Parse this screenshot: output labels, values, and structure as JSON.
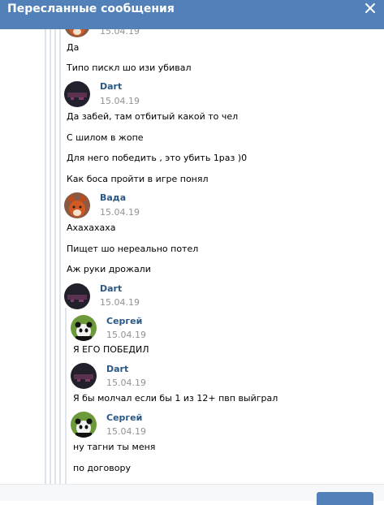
{
  "header": {
    "title": "Пересланные сообщения"
  },
  "messages": [
    {
      "author": "",
      "date": "15.04.19",
      "avatar": "fox-avatar"
    },
    {
      "text": "Да"
    },
    {
      "text": "Типо пискл шо изи убивал"
    },
    {
      "author": "Dart",
      "date": "15.04.19",
      "avatar": "dark-avatar"
    },
    {
      "text": "Да забей, там отбитый какой то чел"
    },
    {
      "text": "С шилом в жопе"
    },
    {
      "text": "Для него победить , это убить 1раз )0"
    },
    {
      "text": "Как боса пройти в игре понял"
    },
    {
      "author": "Вада",
      "date": "15.04.19",
      "avatar": "fox-avatar"
    },
    {
      "text": "Ахахахаха"
    },
    {
      "text": "Пищет шо нереально потел"
    },
    {
      "text": "Аж руки дрожали"
    },
    {
      "author": "Dart",
      "date": "15.04.19",
      "avatar": "dark-avatar"
    },
    {
      "author": "Сергей",
      "date": "15.04.19",
      "avatar": "panda-avatar"
    },
    {
      "text": "Я ЕГО ПОБЕДИЛ"
    },
    {
      "author": "Dart",
      "date": "15.04.19",
      "avatar": "dark-avatar"
    },
    {
      "text": "Я бы молчал если бы 1 из 12+ пвп выйграл"
    },
    {
      "author": "Сергей",
      "date": "15.04.19",
      "avatar": "panda-avatar"
    },
    {
      "text": "ну тагни ты меня"
    },
    {
      "text": "по договору"
    }
  ],
  "colors": {
    "header_bg": "#5181b8",
    "author": "#2a5885",
    "date": "#939393",
    "thread_line": "#dfe4ea"
  }
}
